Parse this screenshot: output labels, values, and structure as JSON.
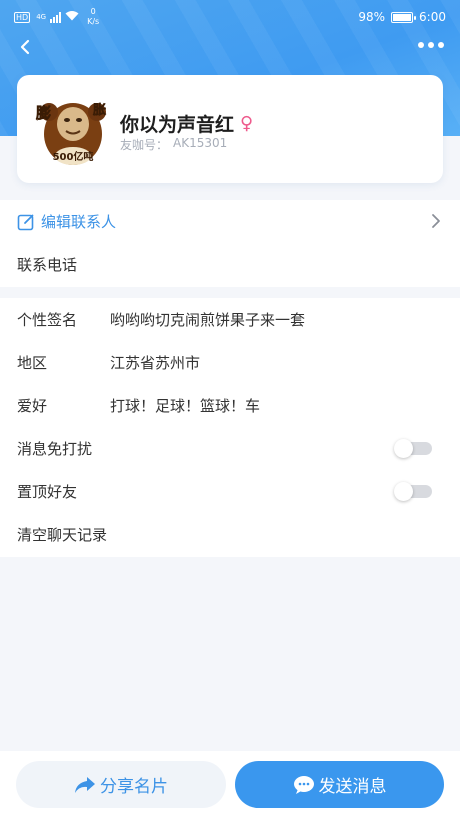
{
  "status_bar": {
    "hd": "HD",
    "network": "4G",
    "speed_value": "0",
    "speed_unit": "K/s",
    "battery": "98%",
    "battery_level": 0.98,
    "time": "6:00"
  },
  "profile": {
    "name": "你以为声音红",
    "gender_symbol": "♀",
    "account_label": "友咖号：",
    "account_id": "AK15301",
    "avatar_text": {
      "left": "膨",
      "right": "胀",
      "badge": "500亿吨"
    }
  },
  "contact": {
    "edit_label": "编辑联系人",
    "phone_label": "联系电话"
  },
  "details": [
    {
      "label": "个性签名",
      "value": "哟哟哟切克闹煎饼果子来一套"
    },
    {
      "label": "地区",
      "value": "江苏省苏州市"
    },
    {
      "label": "爱好",
      "value": "打球！足球！篮球！车"
    }
  ],
  "settings": {
    "mute_label": "消息免打扰",
    "mute_on": false,
    "pin_label": "置顶好友",
    "pin_on": false,
    "clear_label": "清空聊天记录"
  },
  "actions": {
    "share_label": "分享名片",
    "send_label": "发送消息"
  },
  "colors": {
    "accent": "#3a97ee",
    "header": "#4fa6f0",
    "gender": "#ee5a8c"
  },
  "icons": [
    "back-arrow-icon",
    "more-dots-icon",
    "edit-icon",
    "chevron-right-icon",
    "share-arrow-icon",
    "chat-bubble-icon"
  ]
}
